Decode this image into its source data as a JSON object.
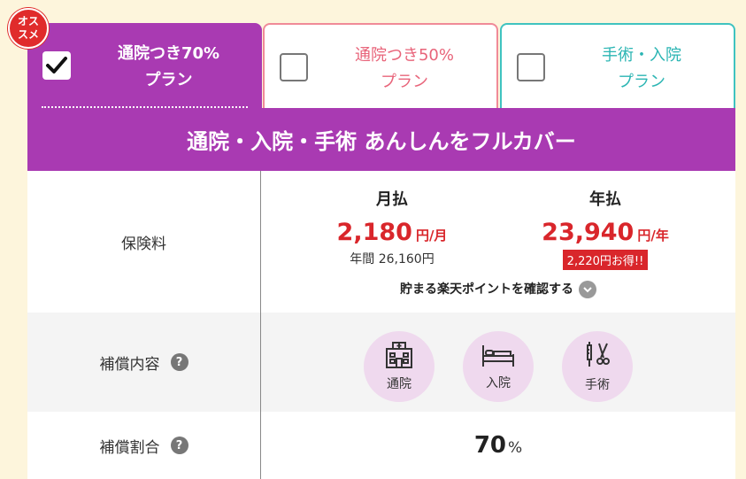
{
  "badge": "オス\nスメ",
  "tabs": [
    {
      "label": "通院つき70%\nプラン",
      "checked": true
    },
    {
      "label": "通院つき50%\nプラン",
      "checked": false
    },
    {
      "label": "手術・入院\nプラン",
      "checked": false
    }
  ],
  "hero": "通院・入院・手術 あんしんをフルカバー",
  "premium": {
    "label": "保険料",
    "monthly": {
      "head": "月払",
      "amount": "2,180",
      "unit": "円/月",
      "sub": "年間 26,160円"
    },
    "yearly": {
      "head": "年払",
      "amount": "23,940",
      "unit": "円/年",
      "save": "2,220円お得!!"
    },
    "points_link": "貯まる楽天ポイントを確認する"
  },
  "coverage": {
    "label": "補償内容",
    "items": [
      {
        "label": "通院",
        "icon": "hospital-icon"
      },
      {
        "label": "入院",
        "icon": "bed-icon"
      },
      {
        "label": "手術",
        "icon": "surgery-icon"
      }
    ]
  },
  "ratio": {
    "label": "補償割合",
    "value": "70",
    "unit": "%"
  },
  "help_mark": "?",
  "colors": {
    "accent": "#a93ab2",
    "price": "#d9262b",
    "tab50": "#e8647a",
    "tabSurgery": "#2bb5b3",
    "background": "#fdf5dc"
  }
}
